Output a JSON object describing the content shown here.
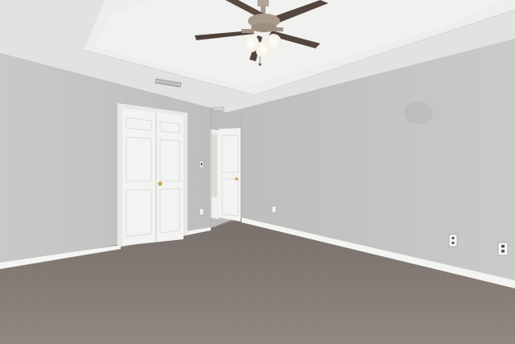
{
  "scene": {
    "colors": {
      "ceiling": "#e4e4e2",
      "tray_ceiling": "#ececea",
      "left_wall": "#c3c3c1",
      "right_wall": "#c5c5c3",
      "back_wall": "#bdbdbb",
      "carpet": "#867c76",
      "trim": "#f4f4f2",
      "door": "#f3f3f1",
      "fan_blade": "#5a4a42",
      "fan_metal": "#a89a8c",
      "light_glass": "#fbfbf4"
    },
    "icons": [
      "ceiling-fan-icon",
      "air-vent-icon",
      "light-switch-icon",
      "outlet-icon",
      "door-knob-icon"
    ]
  }
}
